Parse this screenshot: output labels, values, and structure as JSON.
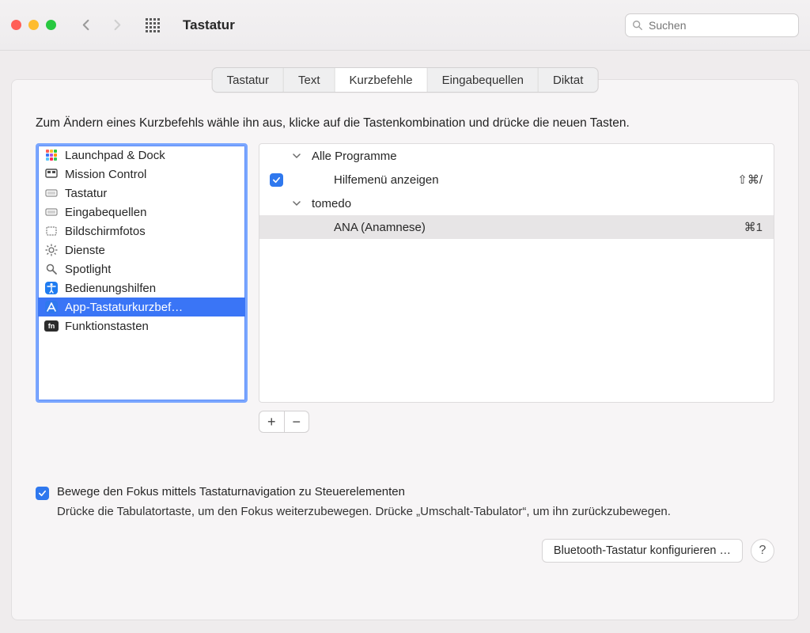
{
  "window": {
    "title": "Tastatur"
  },
  "search": {
    "placeholder": "Suchen"
  },
  "tabs": [
    {
      "label": "Tastatur",
      "active": false
    },
    {
      "label": "Text",
      "active": false
    },
    {
      "label": "Kurzbefehle",
      "active": true
    },
    {
      "label": "Eingabequellen",
      "active": false
    },
    {
      "label": "Diktat",
      "active": false
    }
  ],
  "instruction": "Zum Ändern eines Kurzbefehls wähle ihn aus, klicke auf die Tastenkombination und drücke die neuen Tasten.",
  "sidebar": {
    "items": [
      {
        "label": "Launchpad & Dock",
        "icon": "launchpad"
      },
      {
        "label": "Mission Control",
        "icon": "mission-control"
      },
      {
        "label": "Tastatur",
        "icon": "keyboard"
      },
      {
        "label": "Eingabequellen",
        "icon": "keyboard"
      },
      {
        "label": "Bildschirmfotos",
        "icon": "screenshot"
      },
      {
        "label": "Dienste",
        "icon": "gear"
      },
      {
        "label": "Spotlight",
        "icon": "magnifier"
      },
      {
        "label": "Bedienungshilfen",
        "icon": "accessibility"
      },
      {
        "label": "App-Tastaturkurzbef…",
        "icon": "app",
        "selected": true
      },
      {
        "label": "Funktionstasten",
        "icon": "fn"
      }
    ]
  },
  "shortcuts": {
    "groups": [
      {
        "name": "Alle Programme",
        "expanded": true,
        "items": [
          {
            "label": "Hilfemenü anzeigen",
            "enabled": true,
            "shortcut": "⇧⌘/"
          }
        ]
      },
      {
        "name": "tomedo",
        "expanded": true,
        "items": [
          {
            "label": "ANA (Anamnese)",
            "enabled": false,
            "shortcut": "⌘1",
            "selected": true
          }
        ]
      }
    ]
  },
  "add_label": "+",
  "remove_label": "−",
  "keyboard_nav": {
    "checkbox_label": "Bewege den Fokus mittels Tastaturnavigation zu Steuerelementen",
    "description": "Drücke die Tabulatortaste, um den Fokus weiterzubewegen. Drücke „Umschalt-Tabulator“, um ihn zurückzubewegen."
  },
  "bluetooth_button": "Bluetooth-Tastatur konfigurieren …",
  "help_label": "?"
}
